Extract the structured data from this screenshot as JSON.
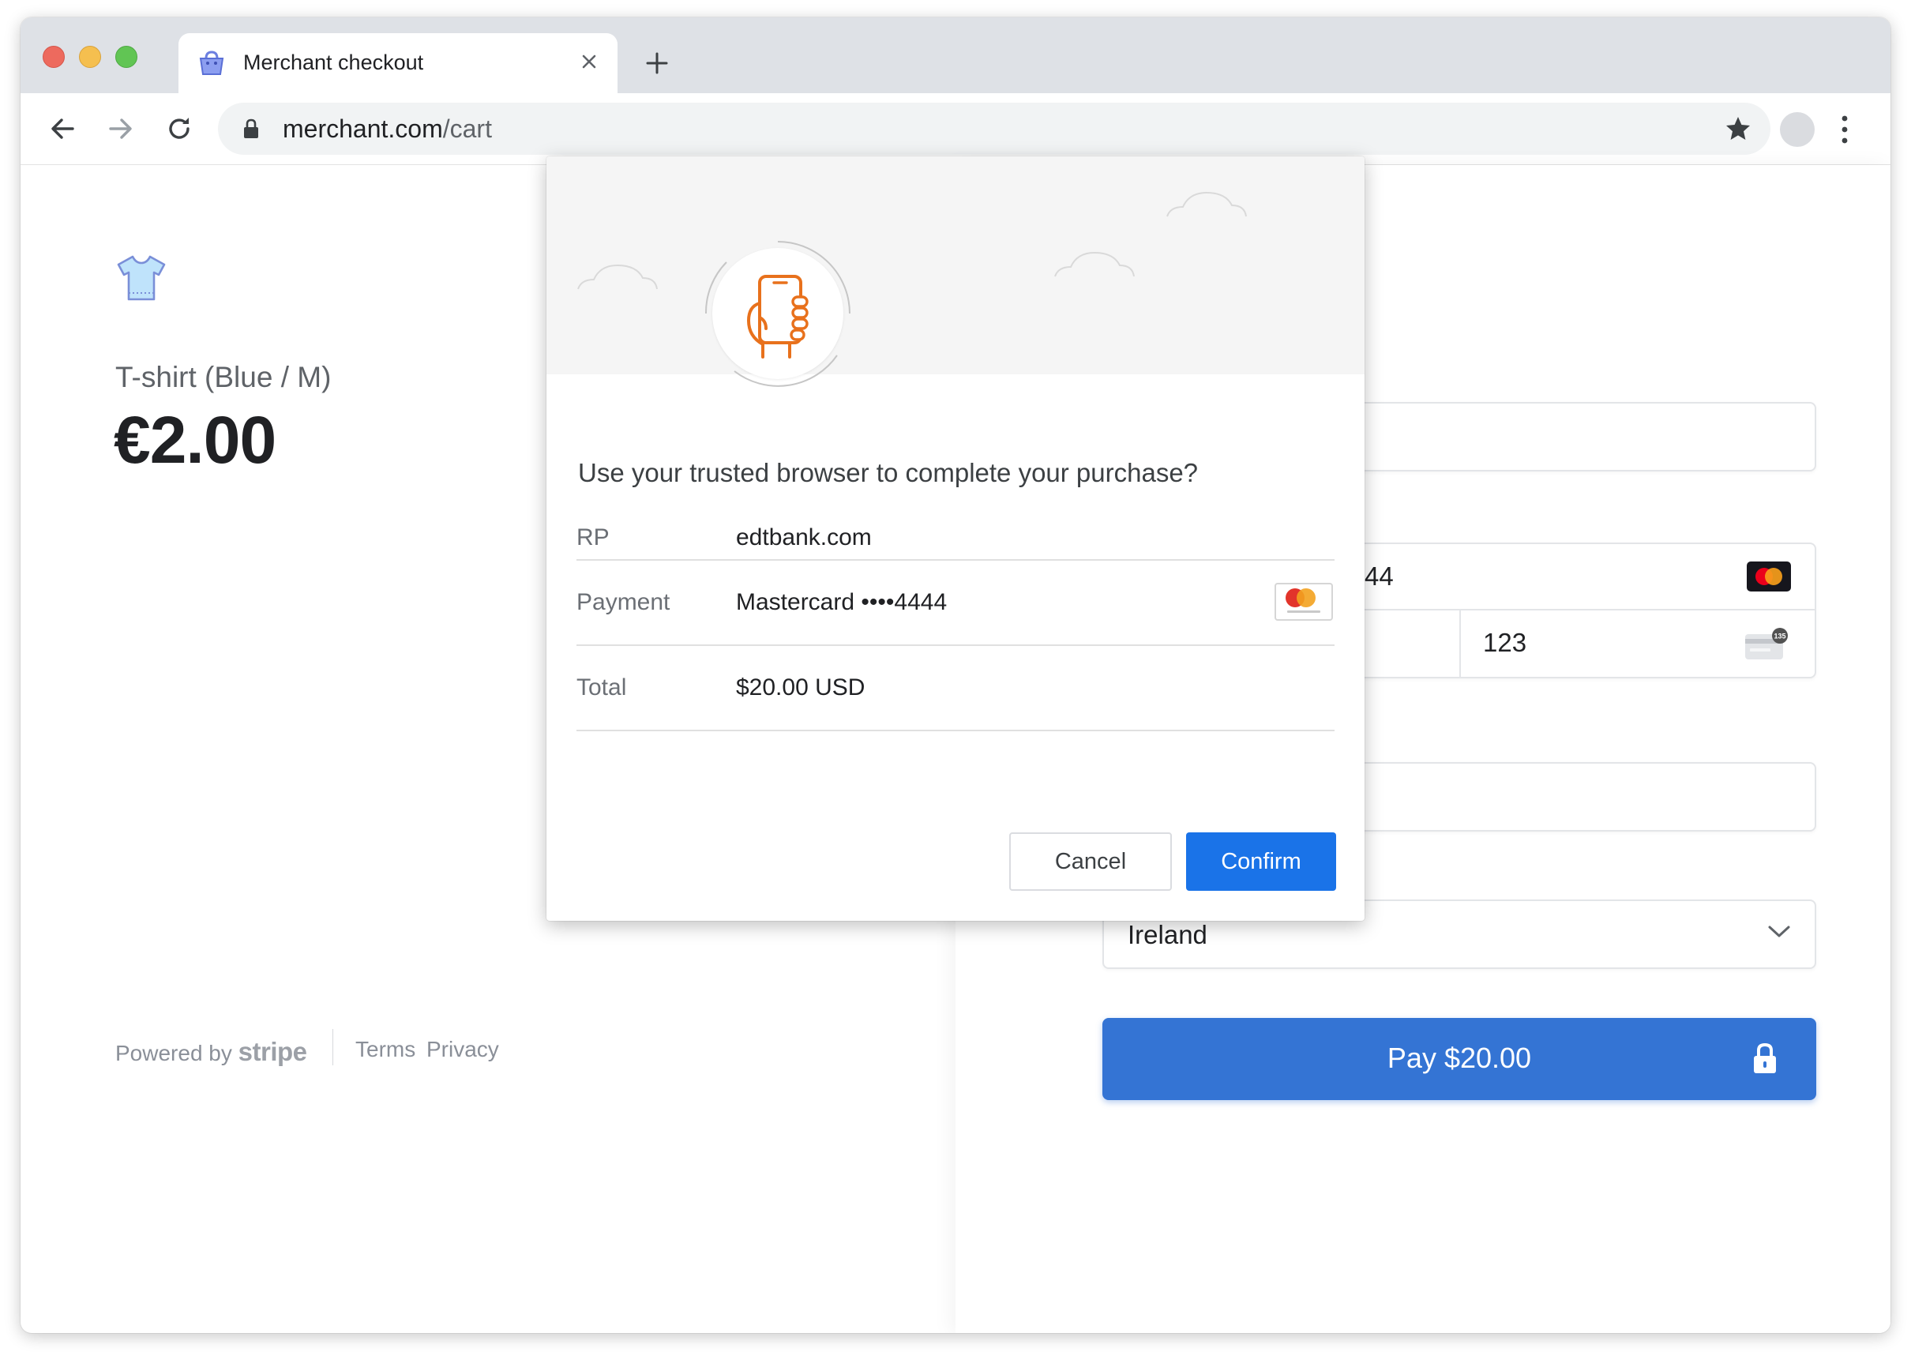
{
  "browser": {
    "tab": {
      "title": "Merchant checkout",
      "favicon": "shopping-bag-icon",
      "close_icon": "close-icon"
    },
    "new_tab_icon": "plus-icon",
    "toolbar": {
      "back_icon": "arrow-left-icon",
      "forward_icon": "arrow-right-icon",
      "reload_icon": "reload-icon",
      "url_host": "merchant.com",
      "url_path": "/cart",
      "bookmark_icon": "star-icon",
      "profile_icon": "avatar",
      "menu_icon": "more-vert-icon"
    }
  },
  "product": {
    "icon": "tshirt-icon",
    "name": "T-shirt (Blue / M)",
    "price": "€2.00"
  },
  "footer": {
    "powered_by": "Powered by",
    "brand": "stripe",
    "terms": "Terms",
    "privacy": "Privacy"
  },
  "checkout_form": {
    "card_number_partial": "44",
    "card_brand_icon": "mastercard-icon",
    "cvc": "123",
    "cvc_icon": "card-cvc-icon",
    "country": "Ireland",
    "pay_button": "Pay $20.00"
  },
  "modal": {
    "hero_icon": "phone-in-hand-icon",
    "question": "Use your trusted browser to complete your purchase?",
    "rows": [
      {
        "label": "RP",
        "value": "edtbank.com"
      },
      {
        "label": "Payment",
        "value": "Mastercard ••••4444"
      },
      {
        "label": "Total",
        "value": "$20.00 USD"
      }
    ],
    "cancel": "Cancel",
    "confirm": "Confirm"
  },
  "colors": {
    "accent_blue": "#1a73e8",
    "pay_button_blue": "#3474d4",
    "hero_orange": "#e8711c",
    "tabstrip_gray": "#dee1e6"
  }
}
